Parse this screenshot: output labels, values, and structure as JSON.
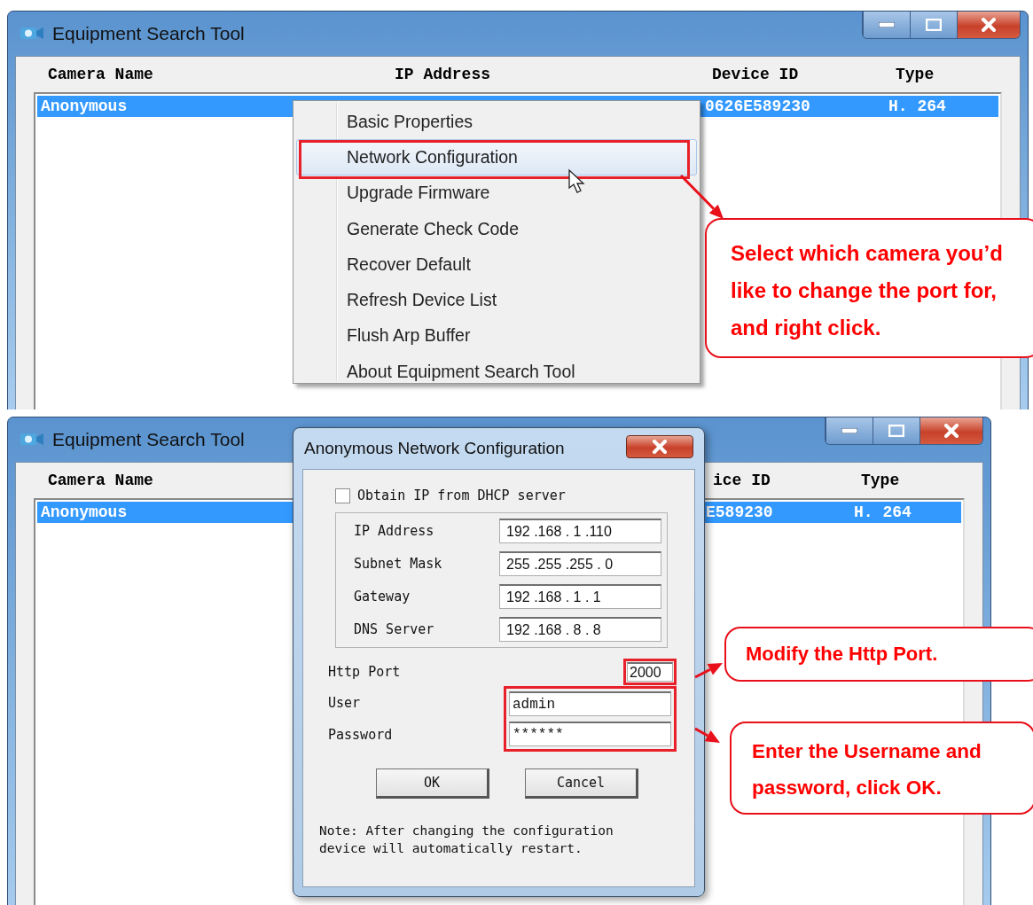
{
  "panels": [
    {
      "window": {
        "title": "Equipment Search Tool"
      },
      "columns": [
        {
          "label": "Camera Name",
          "kind": "name"
        },
        {
          "label": "IP Address",
          "kind": "ip"
        },
        {
          "label": "Device ID",
          "kind": "device"
        },
        {
          "label": "Type",
          "kind": "type"
        }
      ],
      "rows": [
        {
          "selected": true,
          "cells": {
            "name": "Anonymous",
            "device": "0626E589230",
            "type": "H. 264"
          }
        }
      ],
      "context_menu": {
        "items": [
          {
            "label": "Basic Properties",
            "selected": false
          },
          {
            "label": "Network Configuration",
            "selected": true
          },
          {
            "label": "Upgrade Firmware",
            "selected": false
          },
          {
            "label": "Generate Check Code",
            "selected": false
          },
          {
            "label": "Recover Default",
            "selected": false
          },
          {
            "label": "Refresh Device List",
            "selected": false
          },
          {
            "label": "Flush Arp Buffer",
            "selected": false
          },
          {
            "label": "About Equipment Search Tool",
            "selected": false
          }
        ]
      },
      "callouts": [
        {
          "text": "Select which camera you’d like to change the port for, and right click."
        }
      ]
    },
    {
      "window": {
        "title": "Equipment Search Tool"
      },
      "columns": [
        {
          "label": "Camera Name",
          "kind": "name"
        },
        {
          "label": "ice ID",
          "kind": "device"
        },
        {
          "label": "Type",
          "kind": "type"
        }
      ],
      "rows": [
        {
          "selected": true,
          "cells": {
            "name": "Anonymous",
            "device": "E589230",
            "type": "H. 264"
          }
        }
      ],
      "dialog": {
        "title": "Anonymous Network Configuration",
        "dhcp": {
          "label": "Obtain IP from DHCP server",
          "checked": false
        },
        "address_fields": [
          {
            "label": "IP Address",
            "value": "192 .168 . 1 .110"
          },
          {
            "label": "Subnet Mask",
            "value": "255 .255 .255 . 0"
          },
          {
            "label": "Gateway",
            "value": "192 .168 . 1 . 1"
          },
          {
            "label": "DNS Server",
            "value": "192 .168 . 8 . 8"
          }
        ],
        "http_port": {
          "label": "Http Port",
          "value": "2000"
        },
        "user": {
          "label": "User",
          "value": "admin"
        },
        "password": {
          "label": "Password",
          "value": "******"
        },
        "buttons": [
          "OK",
          "Cancel"
        ],
        "note": "Note: After changing the configuration device will automatically restart."
      },
      "callouts": [
        {
          "text": "Modify the Http Port."
        },
        {
          "text": "Enter the Username and password, click OK."
        }
      ]
    }
  ]
}
